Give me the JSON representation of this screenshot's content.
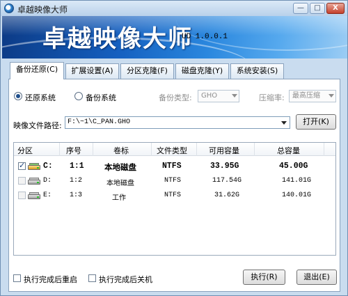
{
  "window": {
    "title": "卓越映像大师",
    "banner_title": "卓越映像大师",
    "version": "UD 1.0.0.1",
    "minimize": "—",
    "maximize": "□",
    "close": "X"
  },
  "tabs": [
    {
      "label": "备份还原(C)",
      "active": true
    },
    {
      "label": "扩展设置(A)",
      "active": false
    },
    {
      "label": "分区克隆(F)",
      "active": false
    },
    {
      "label": "磁盘克隆(Y)",
      "active": false
    },
    {
      "label": "系统安装(S)",
      "active": false
    }
  ],
  "mode": {
    "restore_label": "还原系统",
    "backup_label": "备份系统",
    "selected": "restore"
  },
  "backup_type": {
    "label": "备份类型:",
    "value": "GHO"
  },
  "compression": {
    "label": "压缩率:",
    "value": "最高压缩"
  },
  "image_path": {
    "label": "映像文件路径:",
    "value": "F:\\~1\\C_PAN.GHO"
  },
  "open_button": "打开(K)",
  "table": {
    "columns": [
      "分区",
      "序号",
      "卷标",
      "文件类型",
      "可用容量",
      "总容量"
    ],
    "rows": [
      {
        "drive": "C:",
        "index": "1:1",
        "label": "本地磁盘",
        "fs": "NTFS",
        "free": "33.95G",
        "total": "45.00G",
        "checked": true
      },
      {
        "drive": "D:",
        "index": "1:2",
        "label": "本地磁盘",
        "fs": "NTFS",
        "free": "117.54G",
        "total": "141.01G",
        "checked": false
      },
      {
        "drive": "E:",
        "index": "1:3",
        "label": "工作",
        "fs": "NTFS",
        "free": "31.62G",
        "total": "140.01G",
        "checked": false
      }
    ]
  },
  "options": {
    "reboot_label": "执行完成后重启",
    "shutdown_label": "执行完成后关机"
  },
  "buttons": {
    "execute": "执行(R)",
    "exit": "退出(E)"
  }
}
